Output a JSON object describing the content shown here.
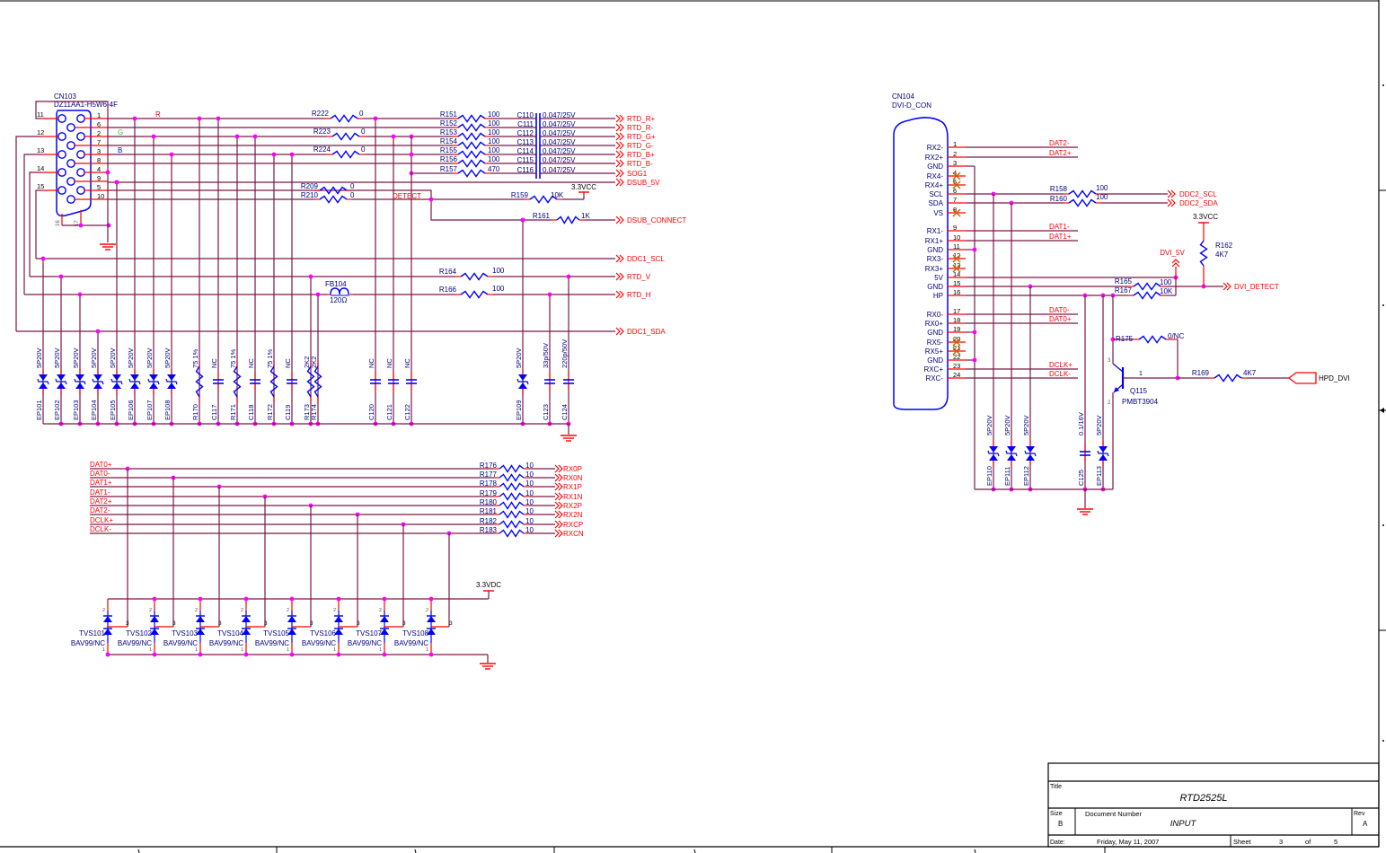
{
  "vga": {
    "connector": {
      "ref": "CN103",
      "part": "DZ11AA1-H5W6-4F",
      "pins_right": [
        "1",
        "6",
        "2",
        "7",
        "3",
        "8",
        "4",
        "9",
        "5",
        "10"
      ],
      "pins_left": [
        "11",
        "12",
        "13",
        "14",
        "15"
      ],
      "pins_bottom": [
        "16",
        "17"
      ]
    },
    "color_tags": {
      "r": "R",
      "g": "G",
      "b": "B"
    },
    "zero_ohm": [
      {
        "ref": "R222",
        "value": "0"
      },
      {
        "ref": "R223",
        "value": "0"
      },
      {
        "ref": "R224",
        "value": "0"
      },
      {
        "ref": "R209",
        "value": "0"
      },
      {
        "ref": "R210",
        "value": "0"
      }
    ],
    "series_r": [
      {
        "ref": "R151",
        "value": "100"
      },
      {
        "ref": "R152",
        "value": "100"
      },
      {
        "ref": "R153",
        "value": "100"
      },
      {
        "ref": "R154",
        "value": "100"
      },
      {
        "ref": "R155",
        "value": "100"
      },
      {
        "ref": "R156",
        "value": "100"
      },
      {
        "ref": "R157",
        "value": "470"
      }
    ],
    "coupling_c": [
      {
        "ref": "C110",
        "value": "0.047/25V"
      },
      {
        "ref": "C111",
        "value": "0.047/25V"
      },
      {
        "ref": "C112",
        "value": "0.047/25V"
      },
      {
        "ref": "C113",
        "value": "0.047/25V"
      },
      {
        "ref": "C114",
        "value": "0.047/25V"
      },
      {
        "ref": "C115",
        "value": "0.047/25V"
      },
      {
        "ref": "C116",
        "value": "0.047/25V"
      }
    ],
    "outputs": [
      "RTD_R+",
      "RTD_R-",
      "RTD_G+",
      "RTD_G-",
      "RTD_B+",
      "RTD_B-",
      "SOG1",
      "DSUB_5V"
    ],
    "detect_label": "DETECT",
    "vcc": "3.3VCC",
    "r159": {
      "ref": "R159",
      "value": "10K"
    },
    "r161": {
      "ref": "R161",
      "value": "1K"
    },
    "dsub_connect": "DSUB_CONNECT",
    "ddc1_scl": "DDC1_SCL",
    "rtd_v": "RTD_V",
    "rtd_h": "RTD_H",
    "ddc1_sda": "DDC1_SDA",
    "r164": {
      "ref": "R164",
      "value": "100"
    },
    "r166": {
      "ref": "R166",
      "value": "100"
    },
    "fb104": {
      "ref": "FB104",
      "value": "120Ω"
    },
    "protection": [
      {
        "ref": "EP101",
        "value": "5P20V",
        "type": "tvs"
      },
      {
        "ref": "EP102",
        "value": "5P20V",
        "type": "tvs"
      },
      {
        "ref": "EP103",
        "value": "5P20V",
        "type": "tvs"
      },
      {
        "ref": "EP104",
        "value": "5P20V",
        "type": "tvs"
      },
      {
        "ref": "EP105",
        "value": "5P20V",
        "type": "tvs"
      },
      {
        "ref": "EP106",
        "value": "5P20V",
        "type": "tvs"
      },
      {
        "ref": "EP107",
        "value": "5P20V",
        "type": "tvs"
      },
      {
        "ref": "EP108",
        "value": "5P20V",
        "type": "tvs"
      },
      {
        "ref": "R170",
        "value": "75 1%",
        "type": "res"
      },
      {
        "ref": "C117",
        "value": "NC",
        "type": "cap"
      },
      {
        "ref": "R171",
        "value": "75 1%",
        "type": "res"
      },
      {
        "ref": "C118",
        "value": "NC",
        "type": "cap"
      },
      {
        "ref": "R172",
        "value": "75 1%",
        "type": "res"
      },
      {
        "ref": "C119",
        "value": "NC",
        "type": "cap"
      },
      {
        "ref": "R173",
        "value": "2K2",
        "type": "res"
      },
      {
        "ref": "R174",
        "value": "2K2",
        "type": "res"
      },
      {
        "ref": "C120",
        "value": "NC",
        "type": "cap"
      },
      {
        "ref": "C121",
        "value": "NC",
        "type": "cap"
      },
      {
        "ref": "C122",
        "value": "NC",
        "type": "cap"
      },
      {
        "ref": "EP109",
        "value": "5P20V",
        "type": "tvs"
      },
      {
        "ref": "C123",
        "value": "33p/50V",
        "type": "cap"
      },
      {
        "ref": "C124",
        "value": "220p/50V",
        "type": "cap"
      }
    ]
  },
  "dvi": {
    "connector": {
      "ref": "CN104",
      "part": "DVI-D_CON"
    },
    "pins": [
      {
        "num": "1",
        "name": "RX2-",
        "nc": false
      },
      {
        "num": "2",
        "name": "RX2+",
        "nc": false
      },
      {
        "num": "3",
        "name": "GND",
        "nc": false
      },
      {
        "num": "4",
        "name": "RX4-",
        "nc": true
      },
      {
        "num": "5",
        "name": "RX4+",
        "nc": true
      },
      {
        "num": "6",
        "name": "SCL",
        "nc": false
      },
      {
        "num": "7",
        "name": "SDA",
        "nc": false
      },
      {
        "num": "8",
        "name": "VS",
        "nc": true
      },
      {
        "num": "9",
        "name": "RX1-",
        "nc": false
      },
      {
        "num": "10",
        "name": "RX1+",
        "nc": false
      },
      {
        "num": "11",
        "name": "GND",
        "nc": false
      },
      {
        "num": "12",
        "name": "RX3-",
        "nc": true
      },
      {
        "num": "13",
        "name": "RX3+",
        "nc": true
      },
      {
        "num": "14",
        "name": "5V",
        "nc": false
      },
      {
        "num": "15",
        "name": "GND",
        "nc": false
      },
      {
        "num": "16",
        "name": "HP",
        "nc": false
      },
      {
        "num": "17",
        "name": "RX0-",
        "nc": false
      },
      {
        "num": "18",
        "name": "RX0+",
        "nc": false
      },
      {
        "num": "19",
        "name": "GND",
        "nc": false
      },
      {
        "num": "20",
        "name": "RX5-",
        "nc": true
      },
      {
        "num": "21",
        "name": "RX5+",
        "nc": true
      },
      {
        "num": "22",
        "name": "GND",
        "nc": false
      },
      {
        "num": "23",
        "name": "RXC+",
        "nc": false
      },
      {
        "num": "24",
        "name": "RXC-",
        "nc": false
      }
    ],
    "nets": {
      "dat2n": "DAT2-",
      "dat2p": "DAT2+",
      "dat1n": "DAT1-",
      "dat1p": "DAT1+",
      "dat0n": "DAT0-",
      "dat0p": "DAT0+",
      "dclkp": "DCLK+",
      "dclkn": "DCLK-"
    },
    "r158": {
      "ref": "R158",
      "value": "100"
    },
    "r160": {
      "ref": "R160",
      "value": "100"
    },
    "ddc2_scl": "DDC2_SCL",
    "ddc2_sda": "DDC2_SDA",
    "vcc": "3.3VCC",
    "r162": {
      "ref": "R162",
      "value": "4K7"
    },
    "dvi_5v": "DVI_5V",
    "r165": {
      "ref": "R165",
      "value": "100"
    },
    "r167": {
      "ref": "R167",
      "value": "10K"
    },
    "dvi_detect": "DVI_DETECT",
    "r175": {
      "ref": "R175",
      "value": "0/NC"
    },
    "q115": {
      "ref": "Q115",
      "part": "PMBT3904",
      "pins": [
        "3",
        "1",
        "2"
      ]
    },
    "r169": {
      "ref": "R169",
      "value": "4K7"
    },
    "hpd_dvi": "HPD_DVI",
    "protection": [
      {
        "ref": "EP110",
        "value": "5P20V",
        "type": "tvs"
      },
      {
        "ref": "EP111",
        "value": "5P20V",
        "type": "tvs"
      },
      {
        "ref": "EP112",
        "value": "5P20V",
        "type": "tvs"
      },
      {
        "ref": "C125",
        "value": "0.1/16V",
        "type": "cap"
      },
      {
        "ref": "EP113",
        "value": "5P20V",
        "type": "tvs"
      }
    ]
  },
  "tmds": {
    "inputs": [
      "DAT0+",
      "DAT0-",
      "DAT1+",
      "DAT1-",
      "DAT2+",
      "DAT2-",
      "DCLK+",
      "DCLK-"
    ],
    "resistors": [
      {
        "ref": "R176",
        "value": "10"
      },
      {
        "ref": "R177",
        "value": "10"
      },
      {
        "ref": "R178",
        "value": "10"
      },
      {
        "ref": "R179",
        "value": "10"
      },
      {
        "ref": "R180",
        "value": "10"
      },
      {
        "ref": "R181",
        "value": "10"
      },
      {
        "ref": "R182",
        "value": "10"
      },
      {
        "ref": "R183",
        "value": "10"
      }
    ],
    "outputs": [
      "RX0P",
      "RX0N",
      "RX1P",
      "RX1N",
      "RX2P",
      "RX2N",
      "RXCP",
      "RXCN"
    ],
    "tvs": [
      {
        "ref": "TVS101",
        "part": "BAV99/NC"
      },
      {
        "ref": "TVS102",
        "part": "BAV99/NC"
      },
      {
        "ref": "TVS103",
        "part": "BAV99/NC"
      },
      {
        "ref": "TVS104",
        "part": "BAV99/NC"
      },
      {
        "ref": "TVS105",
        "part": "BAV99/NC"
      },
      {
        "ref": "TVS106",
        "part": "BAV99/NC"
      },
      {
        "ref": "TVS107",
        "part": "BAV99/NC"
      },
      {
        "ref": "TVS108",
        "part": "BAV99/NC"
      }
    ],
    "tvs_pins": [
      "2",
      "3",
      "1"
    ],
    "vcc": "3.3VDC"
  },
  "title_block": {
    "title_label": "Title",
    "title": "RTD2525L",
    "size_label": "Size",
    "size": "B",
    "docnum_label": "Document Number",
    "docnum": "INPUT",
    "rev_label": "Rev",
    "rev": "A",
    "date_label": "Date:",
    "date": "Friday, May 11, 2007",
    "sheet_label": "Sheet",
    "sheet": "3",
    "of_label": "of",
    "sheets": "5"
  },
  "colors": {
    "wire": "#7a1848",
    "pin": "#ff0000",
    "component": "#0000ff",
    "ref_text": "#000080",
    "net_text": "#ff0000",
    "junction": "#ff00ff"
  }
}
